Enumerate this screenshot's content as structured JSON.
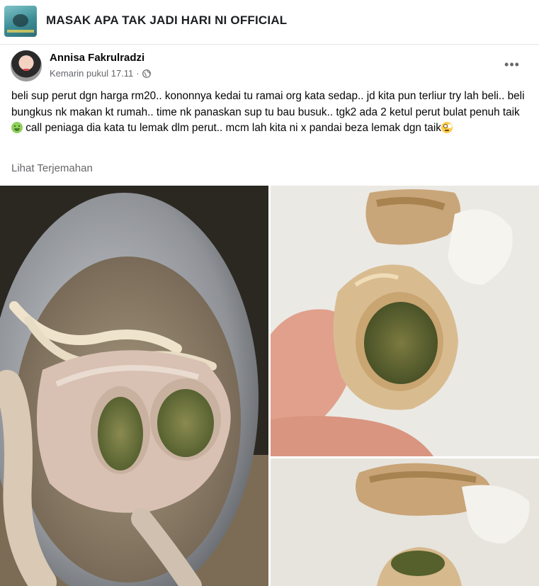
{
  "group": {
    "title": "MASAK APA TAK JADI HARI NI OFFICIAL"
  },
  "post": {
    "author": "Annisa Fakrulradzi",
    "timestamp": "Kemarin pukul 17.11",
    "text_part1": "beli sup perut dgn harga rm20.. kononnya kedai tu ramai org kata sedap.. jd kita pun terliur try lah beli.. beli bungkus nk makan kt rumah.. time nk panaskan sup tu bau busuk.. tgk2 ada 2 ketul perut bulat penuh taik ",
    "text_part2": " call peniaga dia kata tu lemak dlm perut.. mcm lah kita ni x pandai beza lemak dgn taik",
    "translate_label": "Lihat Terjemahan",
    "more_label": "•••"
  },
  "icons": {
    "privacy": "globe-icon",
    "more": "more-options-icon",
    "emoji_1": "nauseated-face-emoji",
    "emoji_2": "eye-roll-face-emoji"
  },
  "colors": {
    "text_primary": "#050505",
    "text_secondary": "#65676b",
    "divider": "#e4e6eb"
  }
}
